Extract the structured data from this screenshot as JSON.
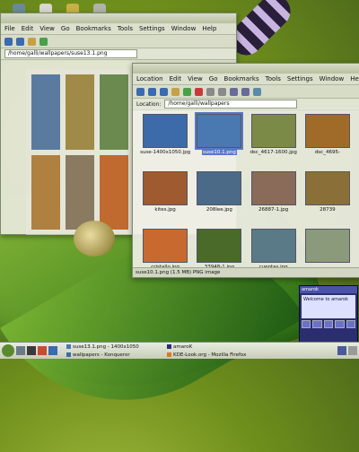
{
  "desktop": {
    "top_icon_names": [
      "monitor-icon",
      "printer-icon",
      "folder-icon",
      "trash-icon"
    ]
  },
  "back_window": {
    "menus": [
      "File",
      "Edit",
      "View",
      "Go",
      "Bookmarks",
      "Tools",
      "Settings",
      "Window",
      "Help"
    ],
    "location": "/home/galli/wallpapers/suse13.1.png"
  },
  "front_window": {
    "menus": [
      "Location",
      "Edit",
      "View",
      "Go",
      "Bookmarks",
      "Tools",
      "Settings",
      "Window",
      "Help"
    ],
    "location_label": "Location:",
    "location": "/home/galli/wallpapers",
    "thumbnails": [
      {
        "name": "suse-1400x1050.jpg",
        "color": "#3d6aa8",
        "selected": false
      },
      {
        "name": "suse10.1.png",
        "color": "#4a78b0",
        "selected": true
      },
      {
        "name": "dsc_4617-1600.jpg",
        "color": "#7c8a48",
        "selected": false
      },
      {
        "name": "dsc_4695-",
        "color": "#a06a28",
        "selected": false
      },
      {
        "name": "kites.jpg",
        "color": "#a05a30",
        "selected": false
      },
      {
        "name": "208lee.jpg",
        "color": "#4a6a88",
        "selected": false
      },
      {
        "name": "26887-1.jpg",
        "color": "#8a6a58",
        "selected": false
      },
      {
        "name": "28739",
        "color": "#8a7038",
        "selected": false
      },
      {
        "name": "cristallo.jpg",
        "color": "#c86a30",
        "selected": false
      },
      {
        "name": "33948-1.jpg",
        "color": "#4a6a2a",
        "selected": false
      },
      {
        "name": "cuentas.jpg",
        "color": "#5a7a88",
        "selected": false
      },
      {
        "name": "",
        "color": "#8a9a7a",
        "selected": false
      }
    ],
    "status": "suse10.1.png (1.5 MB)  PNG image"
  },
  "amarok": {
    "title": "amarok",
    "text": "Welcome to amarok"
  },
  "taskbar": {
    "items": [
      {
        "label": "suse13.1.png - 1400x1050",
        "icon": "image-icon"
      },
      {
        "label": "wallpapers - Konqueror",
        "icon": "konqueror-icon"
      },
      {
        "label": "amaroK",
        "icon": "amarok-icon"
      },
      {
        "label": "KDE-Look.org - Mozilla Firefox",
        "icon": "firefox-icon"
      }
    ],
    "colors": {
      "accent": "#5a78c8",
      "amarok_bg": "#2a2e70"
    }
  }
}
